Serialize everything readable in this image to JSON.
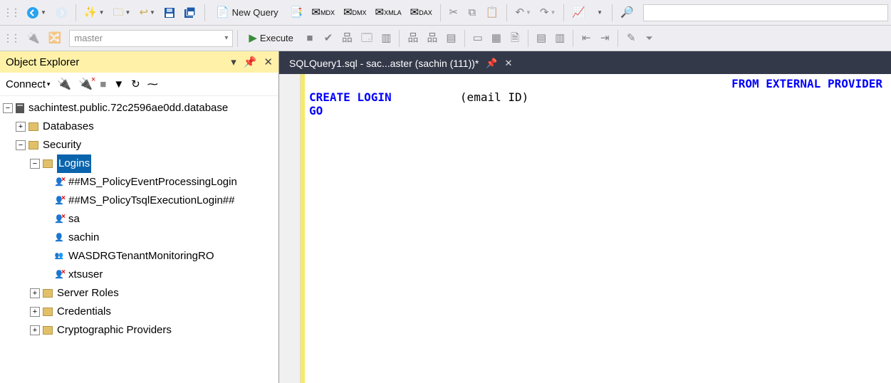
{
  "toolbar1": {
    "new_query": "New Query"
  },
  "toolbar2": {
    "db_combo": "master",
    "execute": "Execute"
  },
  "object_explorer": {
    "title": "Object Explorer",
    "connect_label": "Connect",
    "server": "sachintest.public.72c2596ae0dd.database",
    "nodes": {
      "databases": "Databases",
      "security": "Security",
      "logins": "Logins",
      "login_items": [
        "##MS_PolicyEventProcessingLogin",
        "##MS_PolicyTsqlExecutionLogin##",
        "sa",
        "sachin",
        "WASDRGTenantMonitoringRO",
        "xtsuser"
      ],
      "server_roles": "Server Roles",
      "credentials": "Credentials",
      "crypto_providers": "Cryptographic Providers"
    }
  },
  "editor": {
    "tab_title": "SQLQuery1.sql - sac...aster (sachin (111))*",
    "code": {
      "line1_kw": "CREATE LOGIN",
      "line1_placeholder": "(email ID)",
      "line1_right": "FROM EXTERNAL PROVIDER",
      "line2": "GO"
    }
  }
}
